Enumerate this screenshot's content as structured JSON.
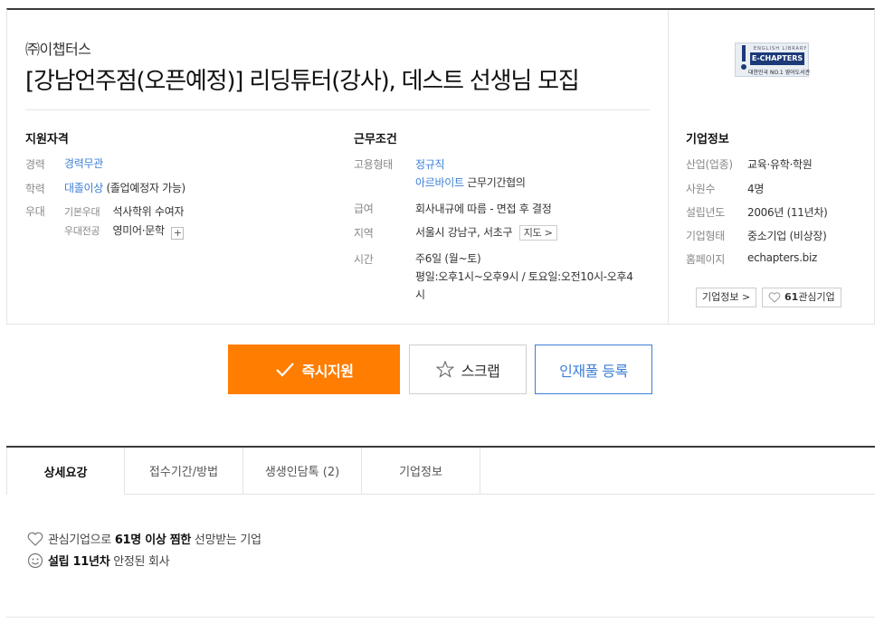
{
  "job": {
    "company": "㈜이챕터스",
    "title": "[강남언주점(오픈예정)] 리딩튜터(강사), 데스트 선생님 모집"
  },
  "qualification": {
    "heading": "지원자격",
    "career_label": "경력",
    "career_value": "경력무관",
    "education_label": "학력",
    "education_value": "대졸이상",
    "education_note": "(졸업예정자 가능)",
    "preference_label": "우대",
    "basic_pref_label": "기본우대",
    "basic_pref_value": "석사학위 수여자",
    "major_pref_label": "우대전공",
    "major_pref_value": "영미어·문학",
    "plus": "+"
  },
  "conditions": {
    "heading": "근무조건",
    "employment_label": "고용형태",
    "employment_value1": "정규직",
    "employment_value2": "아르바이트",
    "employment_note": "근무기간협의",
    "salary_label": "급여",
    "salary_value": "회사내규에 따름 - 면접 후 결정",
    "region_label": "지역",
    "region_value": "서울시 강남구, 서초구",
    "map_button": "지도 >",
    "time_label": "시간",
    "time_value1": "주6일 (월~토)",
    "time_value2": "평일:오후1시~오후9시 / 토요일:오전10시-오후4",
    "time_value3": "시"
  },
  "company_info": {
    "logo_small": "ENGLISH LIBRARY",
    "logo_brand": "E-CHAPTERS",
    "logo_tag": "대한민국 NO.1 영어도서관",
    "heading": "기업정보",
    "industry_label": "산업(업종)",
    "industry_value": "교육·유학·학원",
    "employees_label": "사원수",
    "employees_value": "4명",
    "founded_label": "설립년도",
    "founded_value": "2006년 (11년차)",
    "type_label": "기업형태",
    "type_value": "중소기업 (비상장)",
    "homepage_label": "홈페이지",
    "homepage_value": "echapters.biz",
    "info_button": "기업정보 >",
    "interest_count": "61",
    "interest_label": "관심기업"
  },
  "actions": {
    "apply": "즉시지원",
    "scrap": "스크랩",
    "talent": "인재풀 등록"
  },
  "tabs": [
    "상세요강",
    "접수기간/방법",
    "생생인담톡 (2)",
    "기업정보"
  ],
  "features": {
    "f1_pre": "관심기업으로",
    "f1_bold": "61명 이상 찜한",
    "f1_post": "선망받는 기업",
    "f2_bold": "설립 11년차",
    "f2_post": "안정된 회사"
  },
  "colors": {
    "accent": "#ff7d00",
    "link": "#3d7fd8"
  }
}
